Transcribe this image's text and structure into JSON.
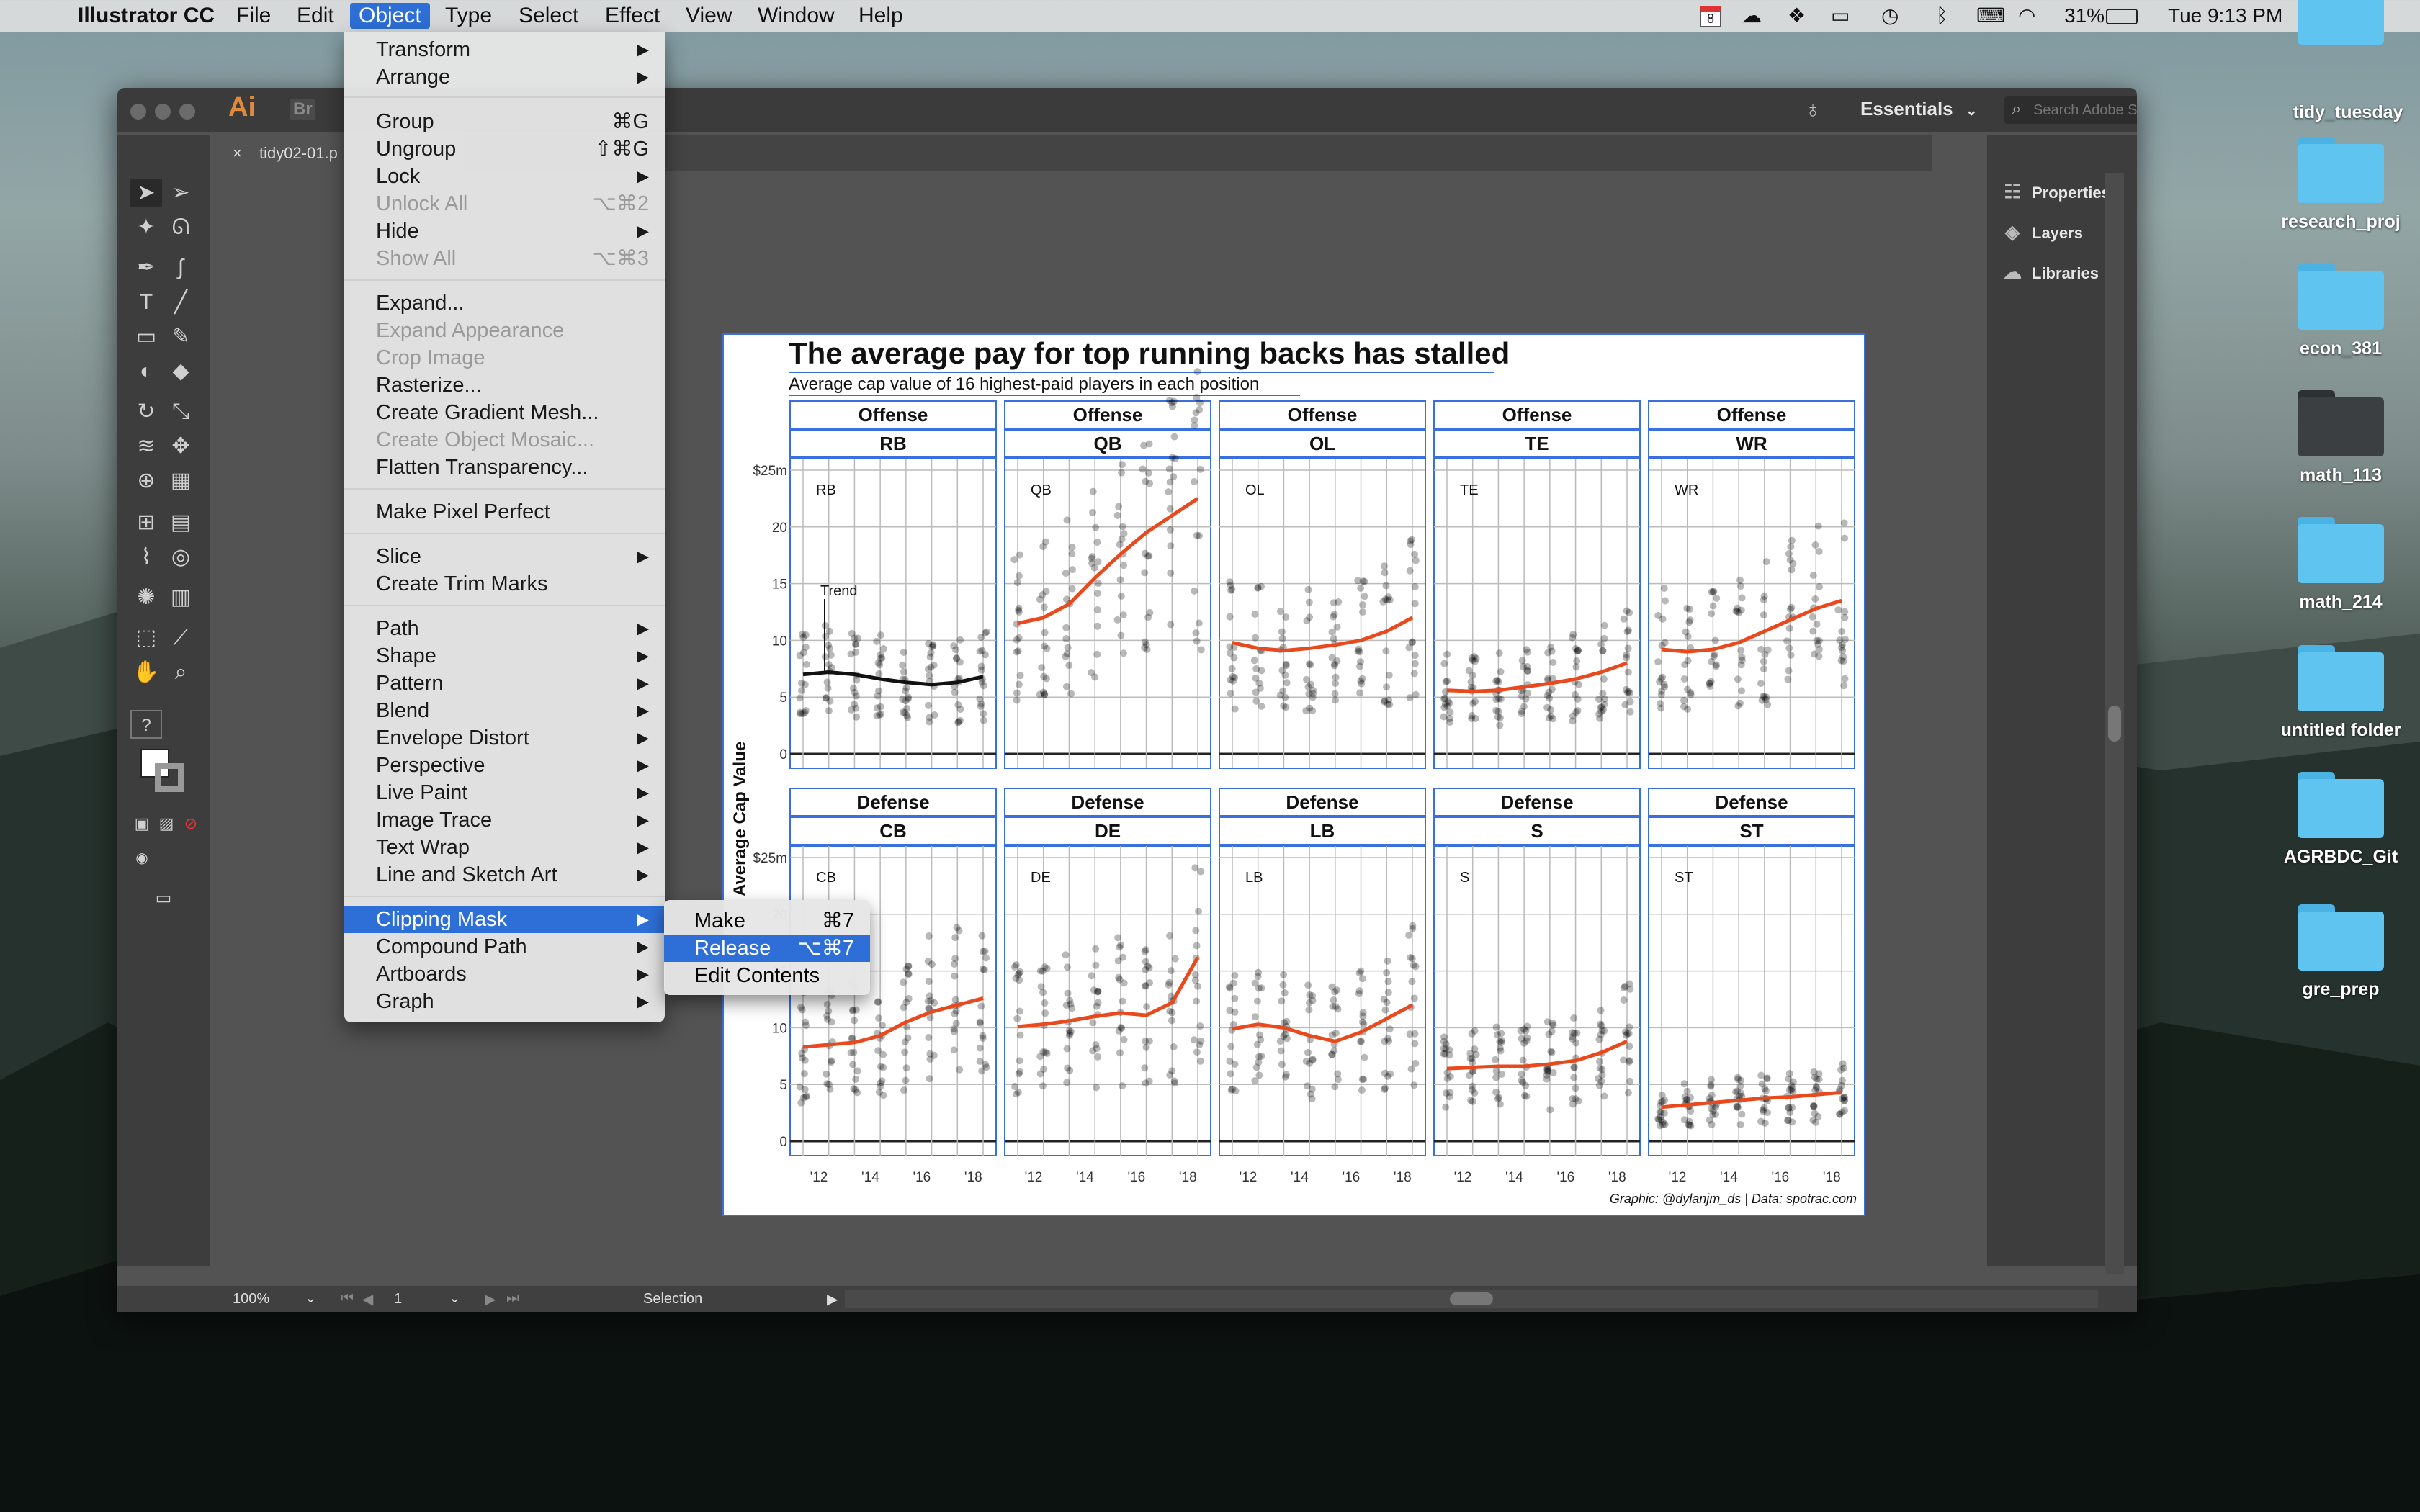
{
  "menubar": {
    "apple": "",
    "app": "Illustrator CC",
    "items": [
      "File",
      "Edit",
      "Object",
      "Type",
      "Select",
      "Effect",
      "View",
      "Window",
      "Help"
    ],
    "battery": "31%",
    "clock": "Tue 9:13 PM",
    "calendar_day": "8"
  },
  "window": {
    "app_logo": "Ai",
    "bridge_logo": "Br",
    "tab": "tidy02-01.p",
    "tab_close": "×",
    "workspace": "Essentials",
    "search_placeholder": "Search Adobe Stock",
    "panels": [
      "Properties",
      "Layers",
      "Libraries"
    ],
    "zoom": "100%",
    "artboard_nav": "1",
    "status": "Selection"
  },
  "menu": {
    "items": [
      {
        "label": "Transform",
        "arrow": "▶"
      },
      {
        "label": "Arrange",
        "arrow": "▶"
      },
      {
        "label": "Group",
        "shortcut": "⌘G"
      },
      {
        "label": "Ungroup",
        "shortcut": "⇧⌘G"
      },
      {
        "label": "Lock",
        "arrow": "▶"
      },
      {
        "label": "Unlock All",
        "shortcut": "⌥⌘2",
        "disabled": true
      },
      {
        "label": "Hide",
        "arrow": "▶"
      },
      {
        "label": "Show All",
        "shortcut": "⌥⌘3",
        "disabled": true
      },
      {
        "label": "Expand..."
      },
      {
        "label": "Expand Appearance",
        "disabled": true
      },
      {
        "label": "Crop Image",
        "disabled": true
      },
      {
        "label": "Rasterize..."
      },
      {
        "label": "Create Gradient Mesh..."
      },
      {
        "label": "Create Object Mosaic...",
        "disabled": true
      },
      {
        "label": "Flatten Transparency..."
      },
      {
        "label": "Make Pixel Perfect"
      },
      {
        "label": "Slice",
        "arrow": "▶"
      },
      {
        "label": "Create Trim Marks"
      },
      {
        "label": "Path",
        "arrow": "▶"
      },
      {
        "label": "Shape",
        "arrow": "▶"
      },
      {
        "label": "Pattern",
        "arrow": "▶"
      },
      {
        "label": "Blend",
        "arrow": "▶"
      },
      {
        "label": "Envelope Distort",
        "arrow": "▶"
      },
      {
        "label": "Perspective",
        "arrow": "▶"
      },
      {
        "label": "Live Paint",
        "arrow": "▶"
      },
      {
        "label": "Image Trace",
        "arrow": "▶"
      },
      {
        "label": "Text Wrap",
        "arrow": "▶"
      },
      {
        "label": "Line and Sketch Art",
        "arrow": "▶"
      },
      {
        "label": "Clipping Mask",
        "arrow": "▶",
        "highlighted": true
      },
      {
        "label": "Compound Path",
        "arrow": "▶"
      },
      {
        "label": "Artboards",
        "arrow": "▶"
      },
      {
        "label": "Graph",
        "arrow": "▶"
      }
    ],
    "submenu": [
      {
        "label": "Make",
        "shortcut": "⌘7"
      },
      {
        "label": "Release",
        "shortcut": "⌥⌘7",
        "highlighted": true
      },
      {
        "label": "Edit Contents"
      }
    ]
  },
  "artwork": {
    "title": "The average pay for top running backs has stalled",
    "subtitle": "Average cap value of 16 highest-paid players in each position",
    "ylabel": "Average Cap Value",
    "caption": "Graphic: @dylanjm_ds | Data: spotrac.com",
    "trend_label": "Trend",
    "yticks": [
      "$25m",
      "20",
      "15",
      "10",
      "5",
      "0"
    ],
    "xticks": [
      "'12",
      "'14",
      "'16",
      "'18"
    ],
    "panels": [
      {
        "side": "Offense",
        "pos": "RB",
        "tag": "RB",
        "trend": [
          7.0,
          7.2,
          7.0,
          6.6,
          6.3,
          6.1,
          6.3,
          6.8
        ],
        "highlight": false
      },
      {
        "side": "Offense",
        "pos": "QB",
        "tag": "QB",
        "trend": [
          11.5,
          12.0,
          13.2,
          15.5,
          17.6,
          19.5,
          21.0,
          22.5
        ],
        "highlight": true
      },
      {
        "side": "Offense",
        "pos": "OL",
        "tag": "OL",
        "trend": [
          9.8,
          9.3,
          9.1,
          9.3,
          9.6,
          10.0,
          10.8,
          12.0
        ],
        "highlight": true
      },
      {
        "side": "Offense",
        "pos": "TE",
        "tag": "TE",
        "trend": [
          5.6,
          5.5,
          5.6,
          5.9,
          6.2,
          6.6,
          7.2,
          8.0
        ],
        "highlight": true
      },
      {
        "side": "Offense",
        "pos": "WR",
        "tag": "WR",
        "trend": [
          9.2,
          9.0,
          9.2,
          9.8,
          10.8,
          11.8,
          12.8,
          13.5
        ],
        "highlight": true
      },
      {
        "side": "Defense",
        "pos": "CB",
        "tag": "CB",
        "trend": [
          8.3,
          8.5,
          8.7,
          9.3,
          10.5,
          11.4,
          12.0,
          12.6
        ],
        "highlight": true
      },
      {
        "side": "Defense",
        "pos": "DE",
        "tag": "DE",
        "trend": [
          10.1,
          10.3,
          10.6,
          11.0,
          11.3,
          11.1,
          12.2,
          16.2
        ],
        "highlight": true
      },
      {
        "side": "Defense",
        "pos": "LB",
        "tag": "LB",
        "trend": [
          9.9,
          10.3,
          10.0,
          9.3,
          8.8,
          9.6,
          10.8,
          12.0
        ],
        "highlight": true
      },
      {
        "side": "Defense",
        "pos": "S",
        "tag": "S",
        "trend": [
          6.4,
          6.5,
          6.6,
          6.6,
          6.8,
          7.1,
          7.8,
          8.8
        ],
        "highlight": true
      },
      {
        "side": "Defense",
        "pos": "ST",
        "tag": "ST",
        "trend": [
          3.0,
          3.2,
          3.4,
          3.6,
          3.8,
          3.9,
          4.1,
          4.3
        ],
        "highlight": true
      }
    ]
  },
  "desktop": {
    "folders": [
      "tidy_tuesday",
      "research_proj",
      "econ_381",
      "math_113",
      "math_214",
      "untitled folder",
      "AGRBDC_Git",
      "gre_prep"
    ]
  },
  "colors": {
    "trend": "#e8491d",
    "rb_trend": "#111111",
    "selection": "#3a6fe0",
    "menu_highlight": "#2d6fd6"
  }
}
